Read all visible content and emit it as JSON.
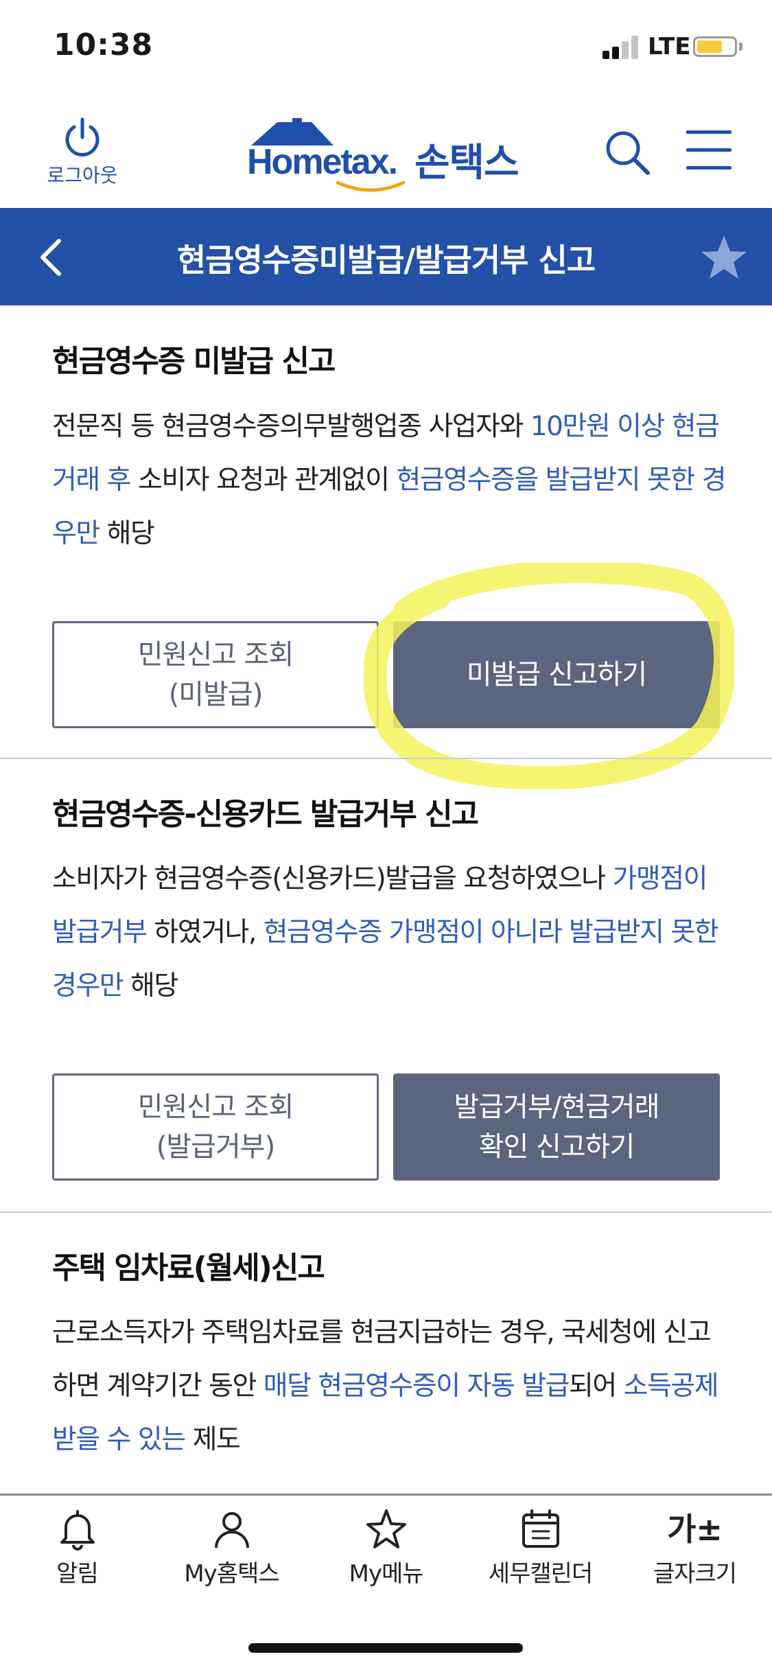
{
  "status_bar": {
    "time": "10:38",
    "network": "LTE",
    "battery_level": 0.7
  },
  "header": {
    "logout_label": "로그아웃",
    "logo_text": "Hometax.",
    "logo_sub": "손택스",
    "icons": {
      "logout": "power-icon",
      "search": "search-icon",
      "menu": "hamburger-menu-icon"
    }
  },
  "title_bar": {
    "title": "현금영수증미발급/발급거부 신고",
    "back_icon": "chevron-left-icon",
    "favorite_icon": "star-icon"
  },
  "section1": {
    "title": "현금영수증 미발급 신고",
    "desc": [
      {
        "t": "전문직 등 현금영수증의무발행업종 사업자와 ",
        "hl": false
      },
      {
        "t": "10만원 이상 현금거래 후",
        "hl": true
      },
      {
        "t": " 소비자 요청과 관계없이 ",
        "hl": false
      },
      {
        "t": "현금영수증을 발급받지 못한 경우만",
        "hl": true
      },
      {
        "t": " 해당",
        "hl": false
      }
    ],
    "btn_inquiry_line1": "민원신고 조회",
    "btn_inquiry_line2": "(미발급)",
    "btn_report": "미발급 신고하기"
  },
  "section2": {
    "title": "현금영수증-신용카드 발급거부 신고",
    "desc": [
      {
        "t": "소비자가 현금영수증(신용카드)발급을 요청하였으나 ",
        "hl": false
      },
      {
        "t": "가맹점이 발급거부",
        "hl": true
      },
      {
        "t": " 하였거나, ",
        "hl": false
      },
      {
        "t": "현금영수증 가맹점이 아니라 발급받지 못한 경우만",
        "hl": true
      },
      {
        "t": " 해당",
        "hl": false
      }
    ],
    "btn_inquiry_line1": "민원신고 조회",
    "btn_inquiry_line2": "(발급거부)",
    "btn_report_line1": "발급거부/현금거래",
    "btn_report_line2": "확인 신고하기"
  },
  "section3": {
    "title": "주택 임차료(월세)신고",
    "desc": [
      {
        "t": "근로소득자가 주택임차료를 현금지급하는 경우, 국세청에 신고하면 계약기간 동안 ",
        "hl": false
      },
      {
        "t": "매달 현금영수증이 자동 발급",
        "hl": true
      },
      {
        "t": "되어 ",
        "hl": false
      },
      {
        "t": "소득공제 받을 수 있는",
        "hl": true
      },
      {
        "t": " 제도",
        "hl": false
      }
    ]
  },
  "bottom_nav": [
    {
      "label": "알림",
      "icon": "bell-icon"
    },
    {
      "label": "My홈택스",
      "icon": "person-icon"
    },
    {
      "label": "My메뉴",
      "icon": "star-outline-icon"
    },
    {
      "label": "세무캘린더",
      "icon": "calendar-icon"
    },
    {
      "label": "글자크기",
      "icon": "font-size-icon",
      "glyph": "가±"
    }
  ],
  "colors": {
    "brand_blue": "#2351a8",
    "highlight_text": "#2f5db7",
    "button_solid": "#5c657f",
    "annotation_yellow": "#f4f25a"
  }
}
